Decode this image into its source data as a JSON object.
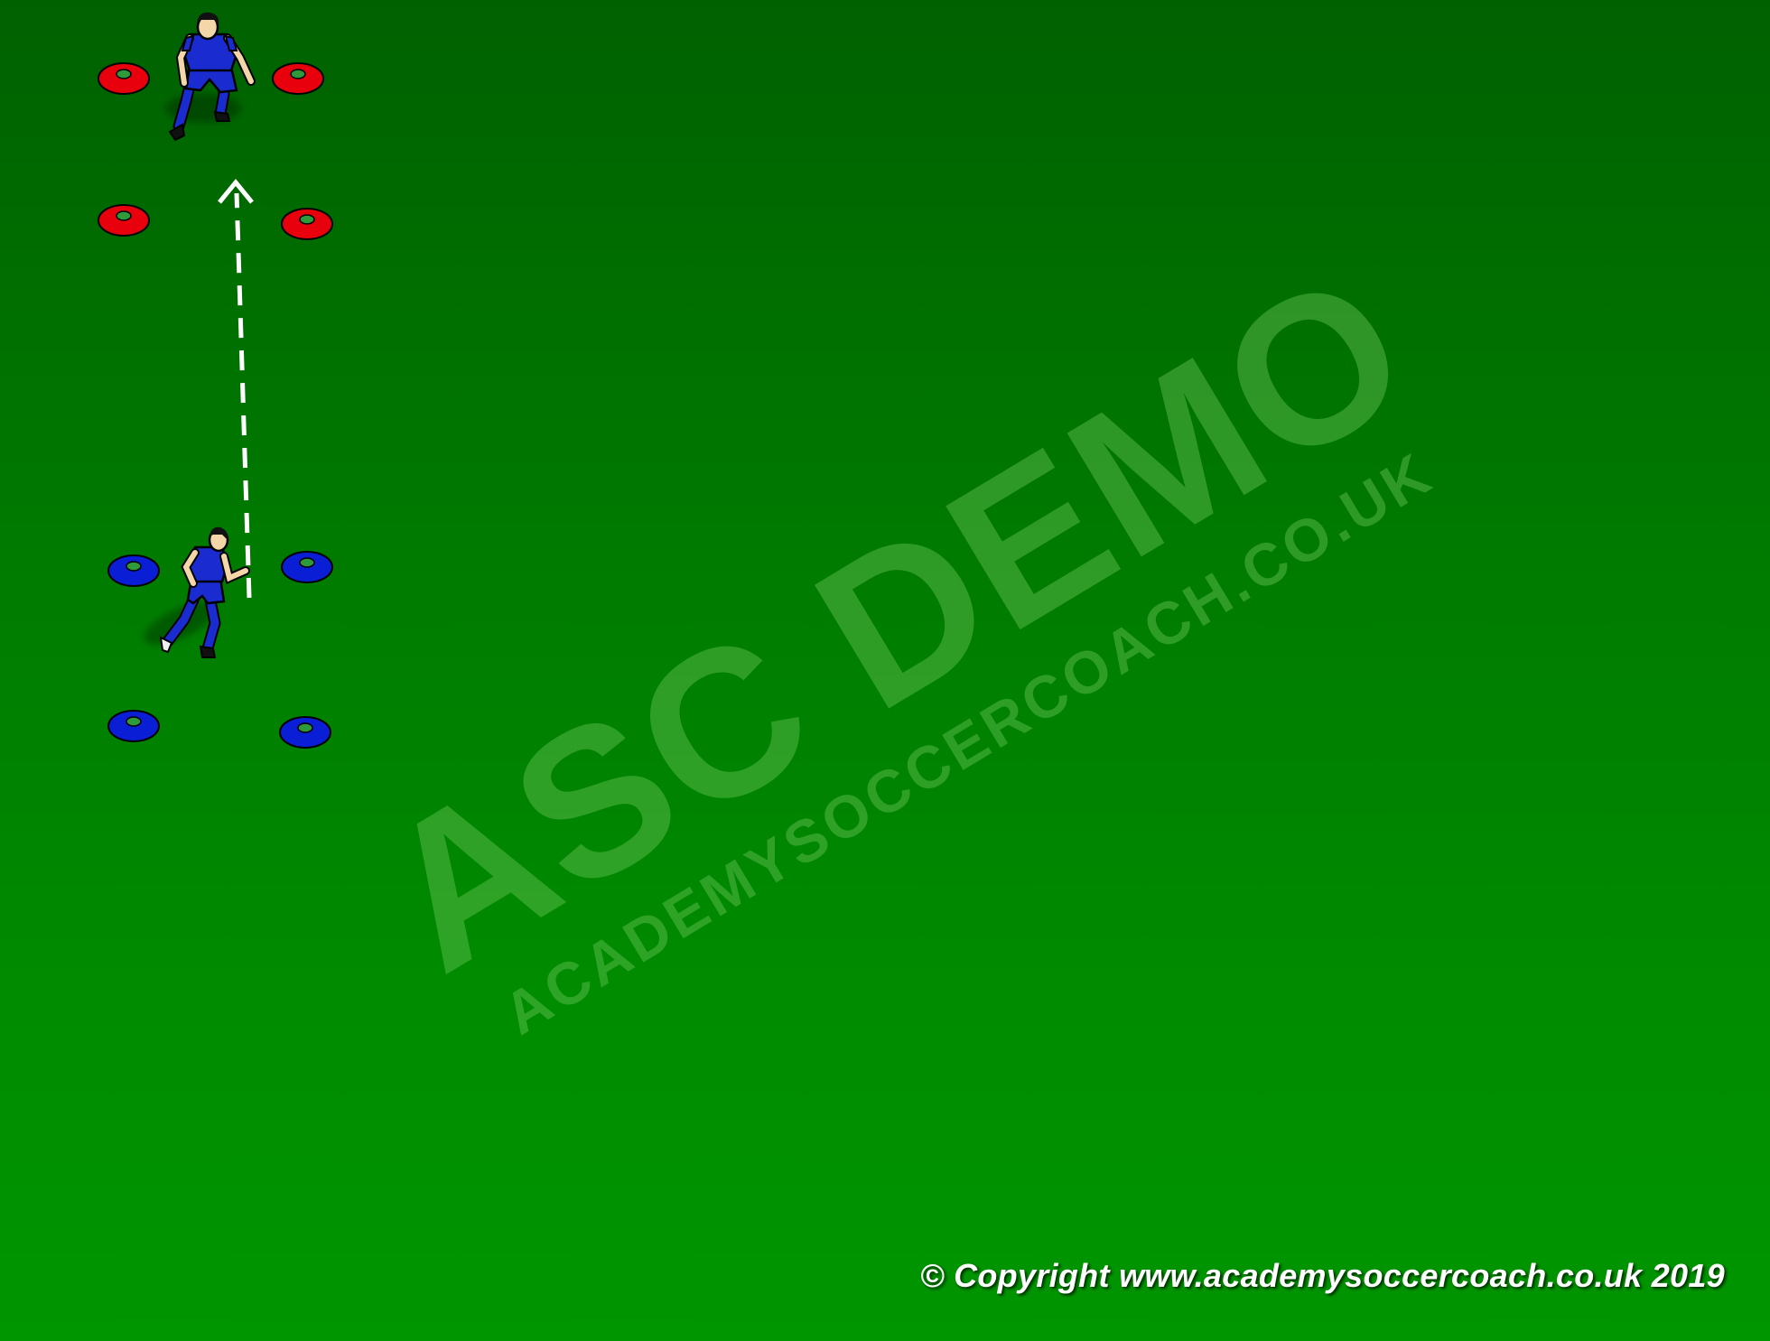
{
  "diagram": {
    "background": {
      "colors": [
        "#006100",
        "#009600"
      ]
    },
    "watermark": {
      "main": "ASC DEMO",
      "sub": "ACADEMYSOCCERCOACH.CO.UK"
    },
    "copyright": "© Copyright www.academysoccercoach.co.uk 2019",
    "cones": {
      "red_color": "#e8000c",
      "blue_color": "#0a1ed6",
      "center_color": "#2f9a3a"
    },
    "players": {
      "kit_color": "#1a2bd0",
      "skin_color": "#f4d7a8"
    },
    "arrow": {
      "style": "dashed",
      "color": "#ffffff"
    }
  }
}
